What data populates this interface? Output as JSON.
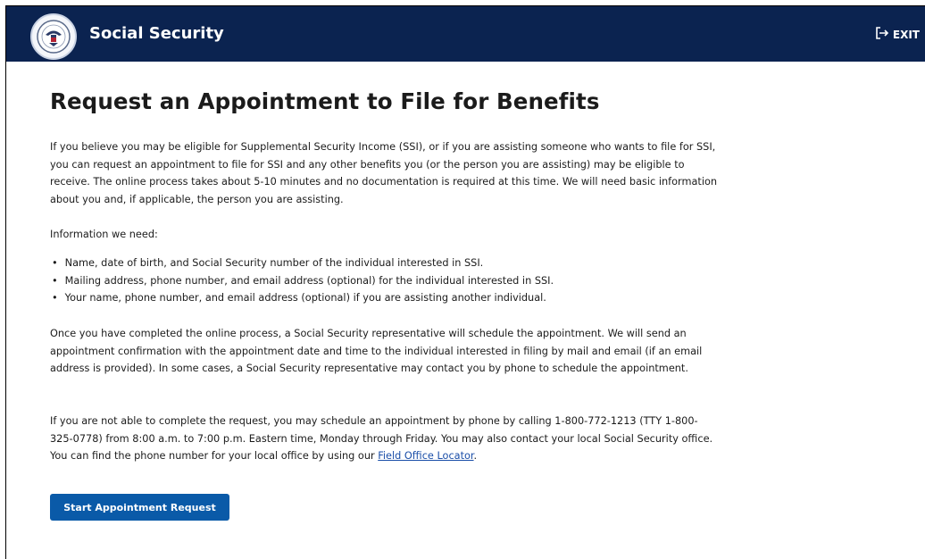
{
  "header": {
    "brand": "Social Security",
    "exit_label": "EXIT",
    "logo_icon": "ssa-seal-icon",
    "exit_icon": "sign-out-icon"
  },
  "main": {
    "title": "Request an Appointment to File for Benefits",
    "intro": "If you believe you may be eligible for Supplemental Security Income (SSI), or if you are assisting someone who wants to file for SSI, you can request an appointment to file for SSI and any other benefits you (or the person you are assisting) may be eligible to receive. The online process takes about 5-10 minutes and no documentation is required at this time. We will need basic information about you and, if applicable, the person you are assisting.",
    "info_heading": "Information we need:",
    "info_items": [
      "Name, date of birth, and Social Security number of the individual interested in SSI.",
      "Mailing address, phone number, and email address (optional) for the individual interested in SSI.",
      "Your name, phone number, and email address (optional) if you are assisting another individual."
    ],
    "process_text": "Once you have completed the online process, a Social Security representative will schedule the appointment. We will send an appointment confirmation with the appointment date and time to the individual interested in filing by mail and email (if an email address is provided). In some cases, a Social Security representative may contact you by phone to schedule the appointment.",
    "phone_text": "If you are not able to complete the request, you may schedule an appointment by phone by calling 1-800-772-1213 (TTY 1-800-325-0778) from 8:00 a.m. to 7:00 p.m. Eastern time, Monday through Friday. You may also contact your local Social Security office. You can find the phone number for your local office by using our ",
    "locator_link": "Field Office Locator",
    "phone_text_end": ".",
    "start_button": "Start Appointment Request"
  },
  "colors": {
    "header_bg": "#0b2350",
    "button_bg": "#0a5aa8",
    "link": "#1a4ea8"
  }
}
